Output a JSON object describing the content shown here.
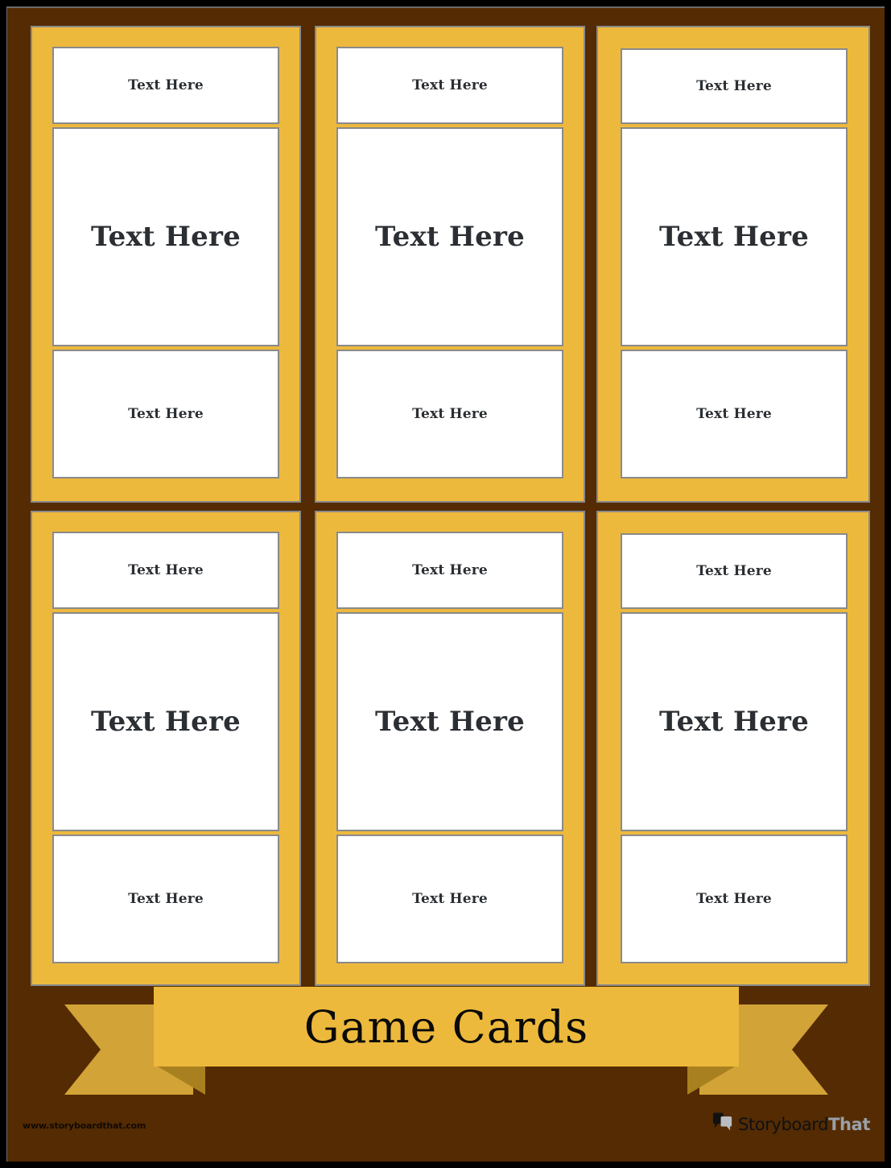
{
  "colors": {
    "background": "#000000",
    "paper": "#542B03",
    "card_gold": "#EDB93C",
    "ribbon_tail": "#D2A337",
    "ribbon_fold": "#A8801F",
    "panel_white": "#FFFFFF",
    "panel_border": "#8A8A8A",
    "text_dark": "#2B2F33",
    "title_black": "#0A0A0A"
  },
  "banner": {
    "title": "Game Cards"
  },
  "footer": {
    "url": "www.storyboardthat.com",
    "brand_primary": "Storyboard",
    "brand_secondary": "That",
    "brand_icon": "speech-bubbles-icon"
  },
  "cards": [
    {
      "id": "card-1",
      "panels": {
        "top": "Text Here",
        "middle": "Text Here",
        "bottom": "Text Here"
      }
    },
    {
      "id": "card-2",
      "panels": {
        "top": "Text Here",
        "middle": "Text Here",
        "bottom": "Text Here"
      }
    },
    {
      "id": "card-3",
      "panels": {
        "top": "Text Here",
        "middle": "Text Here",
        "bottom": "Text Here"
      }
    },
    {
      "id": "card-4",
      "panels": {
        "top": "Text Here",
        "middle": "Text Here",
        "bottom": "Text Here"
      }
    },
    {
      "id": "card-5",
      "panels": {
        "top": "Text Here",
        "middle": "Text Here",
        "bottom": "Text Here"
      }
    },
    {
      "id": "card-6",
      "panels": {
        "top": "Text Here",
        "middle": "Text Here",
        "bottom": "Text Here"
      }
    }
  ]
}
